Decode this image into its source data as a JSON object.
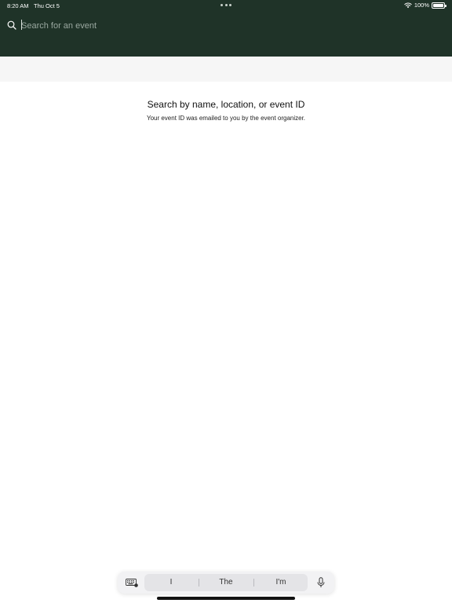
{
  "status_bar": {
    "time": "8:20 AM",
    "date": "Thu Oct 5",
    "battery": "100%"
  },
  "search": {
    "placeholder": "Search for an event",
    "value": ""
  },
  "empty_state": {
    "title": "Search by name, location, or event ID",
    "subtitle": "Your event ID was emailed to you by the event organizer."
  },
  "keyboard": {
    "suggestions": [
      "I",
      "The",
      "I'm"
    ]
  },
  "icons": {
    "search": "search-icon",
    "wifi": "wifi-icon",
    "battery": "battery-icon",
    "keyboard": "keyboard-icon",
    "microphone": "microphone-icon"
  },
  "colors": {
    "header_bg": "#1f3328",
    "band_bg": "#f6f6f6",
    "text_primary": "#111111"
  }
}
